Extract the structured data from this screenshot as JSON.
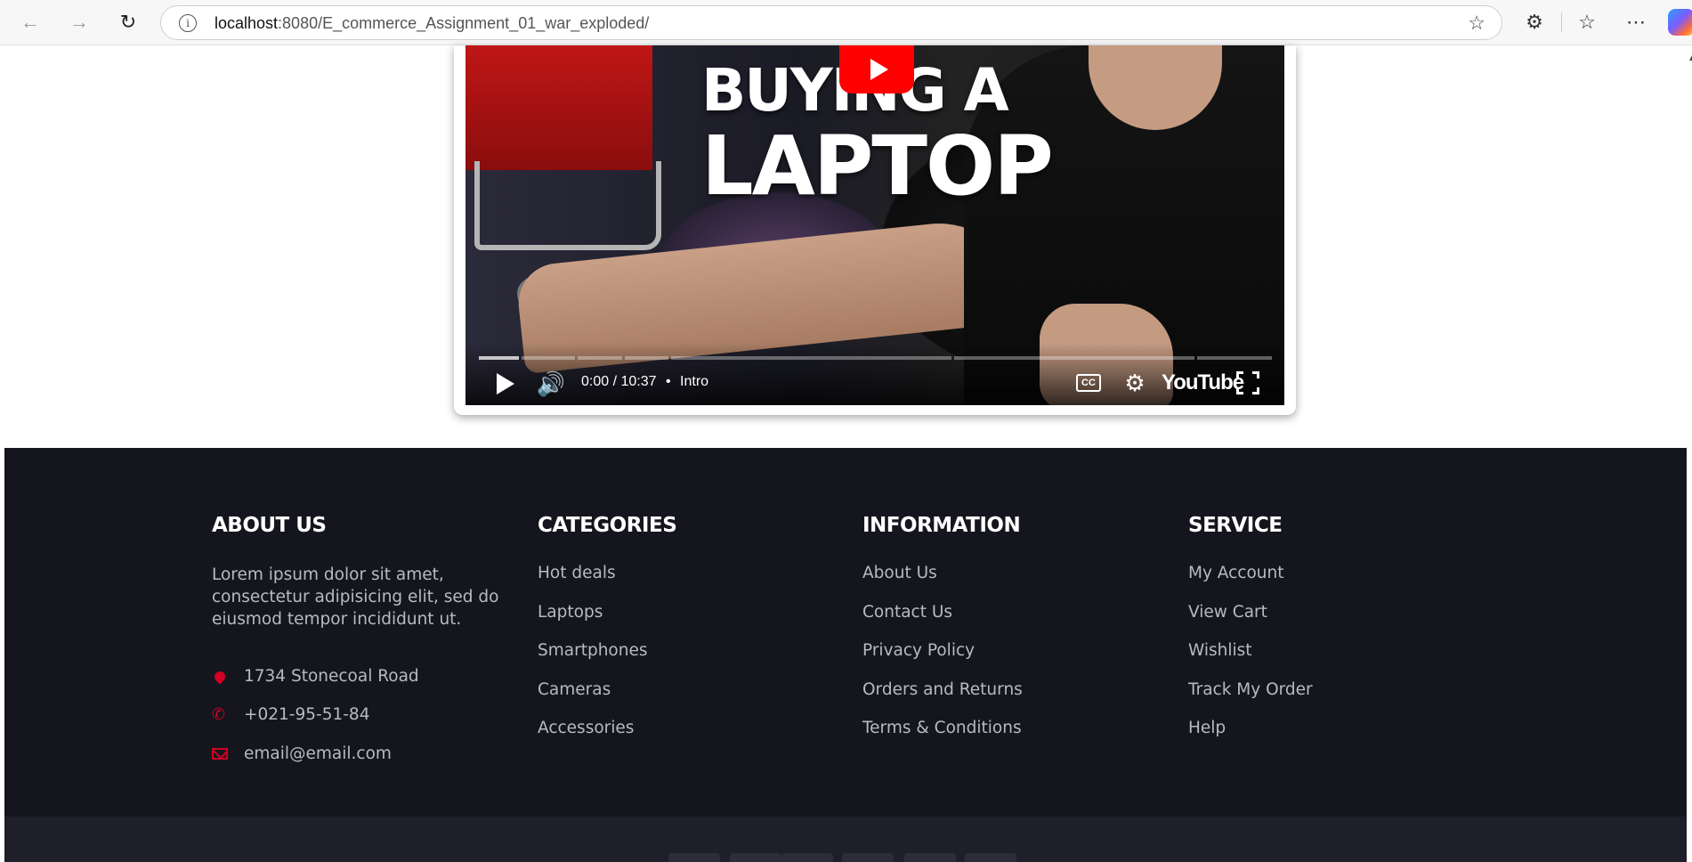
{
  "browser": {
    "url_host": "localhost",
    "url_rest": ":8080/E_commerce_Assignment_01_war_exploded/"
  },
  "video": {
    "thumbnail_line1": "BUYING A",
    "thumbnail_line2": "LAPTOP",
    "time_display": "0:00 / 10:37",
    "chapter_separator": "•",
    "chapter": "Intro",
    "cc_label": "CC",
    "brand": "YouTube",
    "progress_loaded_fraction": 0.05
  },
  "footer": {
    "about": {
      "title": "ABOUT US",
      "text": "Lorem ipsum dolor sit amet, consectetur adipisicing elit, sed do eiusmod tempor incididunt ut.",
      "address": "1734 Stonecoal Road",
      "phone": "+021-95-51-84",
      "email": "email@email.com"
    },
    "categories": {
      "title": "CATEGORIES",
      "items": [
        "Hot deals",
        "Laptops",
        "Smartphones",
        "Cameras",
        "Accessories"
      ]
    },
    "information": {
      "title": "INFORMATION",
      "items": [
        "About Us",
        "Contact Us",
        "Privacy Policy",
        "Orders and Returns",
        "Terms & Conditions"
      ]
    },
    "service": {
      "title": "SERVICE",
      "items": [
        "My Account",
        "View Cart",
        "Wishlist",
        "Track My Order",
        "Help"
      ]
    }
  },
  "colors": {
    "accent": "#D10024",
    "footer_bg": "#15161D",
    "footer_bottom_bg": "#1E1F29",
    "youtube_red": "#FF0000"
  }
}
